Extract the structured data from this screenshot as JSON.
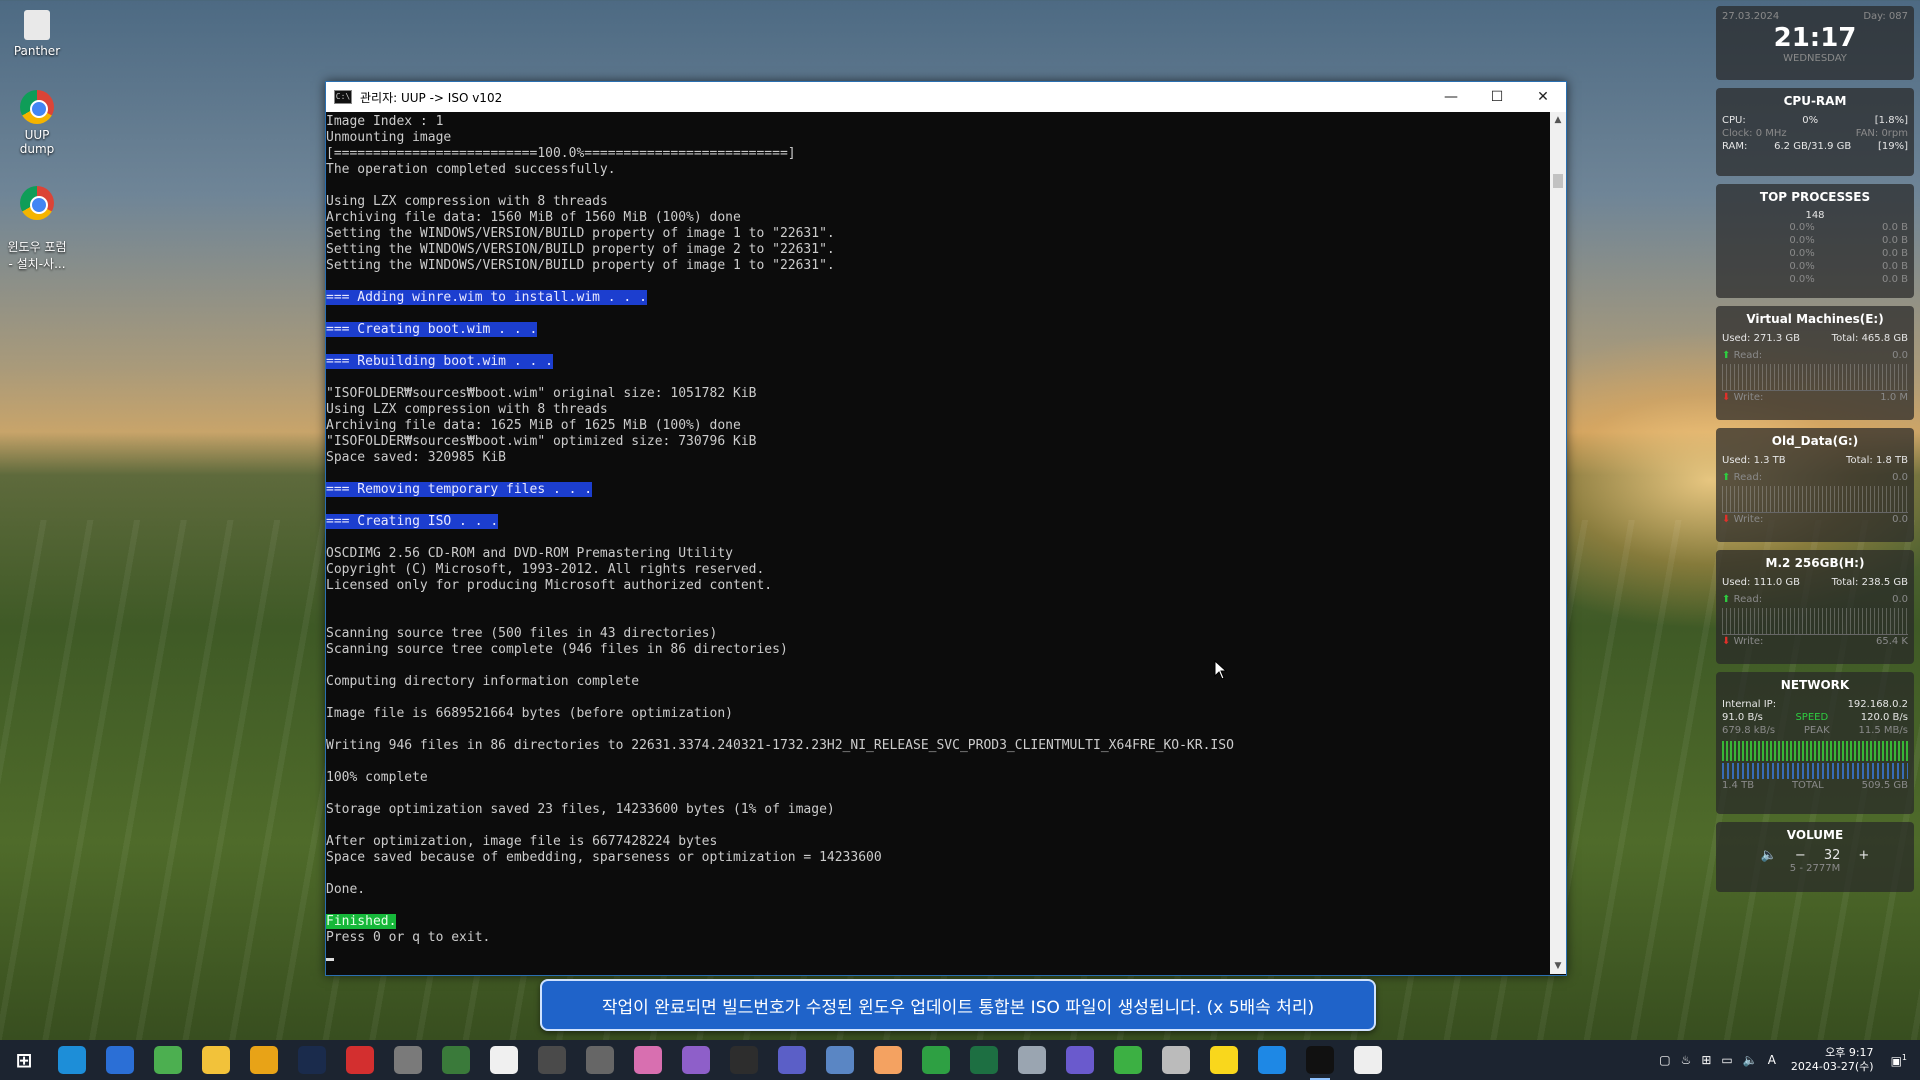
{
  "desktop": {
    "icons": [
      {
        "label": "Panther"
      },
      {
        "label": "UUP dump"
      },
      {
        "label": "윈도우 포럼\n- 설치-사..."
      }
    ]
  },
  "window": {
    "title": "관리자:  UUP -> ISO v102",
    "minimize": "—",
    "maximize": "☐",
    "close": "✕"
  },
  "console": {
    "lines": [
      {
        "text": "Image Index : 1",
        "hl": ""
      },
      {
        "text": "Unmounting image",
        "hl": ""
      },
      {
        "text": "[==========================100.0%==========================]",
        "hl": ""
      },
      {
        "text": "The operation completed successfully.",
        "hl": ""
      },
      {
        "text": "",
        "hl": ""
      },
      {
        "text": "Using LZX compression with 8 threads",
        "hl": ""
      },
      {
        "text": "Archiving file data: 1560 MiB of 1560 MiB (100%) done",
        "hl": ""
      },
      {
        "text": "Setting the WINDOWS/VERSION/BUILD property of image 1 to \"22631\".",
        "hl": ""
      },
      {
        "text": "Setting the WINDOWS/VERSION/BUILD property of image 2 to \"22631\".",
        "hl": ""
      },
      {
        "text": "Setting the WINDOWS/VERSION/BUILD property of image 1 to \"22631\".",
        "hl": ""
      },
      {
        "text": "",
        "hl": ""
      },
      {
        "text": "=== Adding winre.wim to install.wim . . .",
        "hl": "blue"
      },
      {
        "text": "",
        "hl": ""
      },
      {
        "text": "=== Creating boot.wim . . .",
        "hl": "blue"
      },
      {
        "text": "",
        "hl": ""
      },
      {
        "text": "=== Rebuilding boot.wim . . .",
        "hl": "blue"
      },
      {
        "text": "",
        "hl": ""
      },
      {
        "text": "\"ISOFOLDER₩sources₩boot.wim\" original size: 1051782 KiB",
        "hl": ""
      },
      {
        "text": "Using LZX compression with 8 threads",
        "hl": ""
      },
      {
        "text": "Archiving file data: 1625 MiB of 1625 MiB (100%) done",
        "hl": ""
      },
      {
        "text": "\"ISOFOLDER₩sources₩boot.wim\" optimized size: 730796 KiB",
        "hl": ""
      },
      {
        "text": "Space saved: 320985 KiB",
        "hl": ""
      },
      {
        "text": "",
        "hl": ""
      },
      {
        "text": "=== Removing temporary files . . .",
        "hl": "blue"
      },
      {
        "text": "",
        "hl": ""
      },
      {
        "text": "=== Creating ISO . . .",
        "hl": "blue"
      },
      {
        "text": "",
        "hl": ""
      },
      {
        "text": "OSCDIMG 2.56 CD-ROM and DVD-ROM Premastering Utility",
        "hl": ""
      },
      {
        "text": "Copyright (C) Microsoft, 1993-2012. All rights reserved.",
        "hl": ""
      },
      {
        "text": "Licensed only for producing Microsoft authorized content.",
        "hl": ""
      },
      {
        "text": "",
        "hl": ""
      },
      {
        "text": "",
        "hl": ""
      },
      {
        "text": "Scanning source tree (500 files in 43 directories)",
        "hl": ""
      },
      {
        "text": "Scanning source tree complete (946 files in 86 directories)",
        "hl": ""
      },
      {
        "text": "",
        "hl": ""
      },
      {
        "text": "Computing directory information complete",
        "hl": ""
      },
      {
        "text": "",
        "hl": ""
      },
      {
        "text": "Image file is 6689521664 bytes (before optimization)",
        "hl": ""
      },
      {
        "text": "",
        "hl": ""
      },
      {
        "text": "Writing 946 files in 86 directories to 22631.3374.240321-1732.23H2_NI_RELEASE_SVC_PROD3_CLIENTMULTI_X64FRE_KO-KR.ISO",
        "hl": ""
      },
      {
        "text": "",
        "hl": ""
      },
      {
        "text": "100% complete",
        "hl": ""
      },
      {
        "text": "",
        "hl": ""
      },
      {
        "text": "Storage optimization saved 23 files, 14233600 bytes (1% of image)",
        "hl": ""
      },
      {
        "text": "",
        "hl": ""
      },
      {
        "text": "After optimization, image file is 6677428224 bytes",
        "hl": ""
      },
      {
        "text": "Space saved because of embedding, sparseness or optimization = 14233600",
        "hl": ""
      },
      {
        "text": "",
        "hl": ""
      },
      {
        "text": "Done.",
        "hl": ""
      },
      {
        "text": "",
        "hl": ""
      },
      {
        "text": "Finished.",
        "hl": "green"
      },
      {
        "text": "Press 0 or q to exit.",
        "hl": ""
      }
    ]
  },
  "banner": {
    "text": "작업이 완료되면 빌드번호가 수정된 윈도우 업데이트 통합본 ISO 파일이 생성됩니다. (x 5배속 처리)"
  },
  "widgets": {
    "clock": {
      "date": "27.03.2024",
      "day_of_year": "Day: 087",
      "time": "21:17",
      "weekday": "WEDNESDAY"
    },
    "cpuram": {
      "title": "CPU-RAM",
      "cpu_label": "CPU:",
      "cpu_value": "0%",
      "cpu_pct": "[1.8%]",
      "clock_label": "Clock: 0 MHz",
      "fan_label": "FAN: 0rpm",
      "ram_label": "RAM:",
      "ram_value": "6.2 GB/31.9 GB",
      "ram_pct": "[19%]"
    },
    "processes": {
      "title": "TOP PROCESSES",
      "count": "148",
      "rows": [
        {
          "a": "0.0%",
          "b": "0.0 B"
        },
        {
          "a": "0.0%",
          "b": "0.0 B"
        },
        {
          "a": "0.0%",
          "b": "0.0 B"
        },
        {
          "a": "0.0%",
          "b": "0.0 B"
        },
        {
          "a": "0.0%",
          "b": "0.0 B"
        }
      ]
    },
    "drives": [
      {
        "title": "Virtual Machines(E:)",
        "used": "Used: 271.3 GB",
        "total": "Total: 465.8 GB",
        "read": "Read:",
        "read_v": "0.0",
        "write": "Write:",
        "write_v": "1.0 M"
      },
      {
        "title": "Old_Data(G:)",
        "used": "Used: 1.3 TB",
        "total": "Total: 1.8 TB",
        "read": "Read:",
        "read_v": "0.0",
        "write": "Write:",
        "write_v": "0.0"
      },
      {
        "title": "M.2 256GB(H:)",
        "used": "Used: 111.0 GB",
        "total": "Total: 238.5 GB",
        "read": "Read:",
        "read_v": "0.0",
        "write": "Write:",
        "write_v": "65.4 K"
      }
    ],
    "network": {
      "title": "NETWORK",
      "ip_label": "Internal IP:",
      "ip": "192.168.0.2",
      "down_speed": "91.0 B/s",
      "speed_label": "SPEED",
      "up_speed": "120.0 B/s",
      "down_peak": "679.8 kB/s",
      "peak_label": "PEAK",
      "up_peak": "11.5 MB/s",
      "down_total": "1.4 TB",
      "total_label": "TOTAL",
      "up_total": "509.5 GB"
    },
    "volume": {
      "title": "VOLUME",
      "minus": "−",
      "value": "32",
      "plus": "+",
      "device": "5 - 2777M"
    }
  },
  "taskbar": {
    "icons": [
      "start-icon",
      "edge-icon",
      "ie-icon",
      "chrome-icon",
      "file-explorer-icon",
      "app-yellow-icon",
      "photoshop-icon",
      "acrobat-icon",
      "tools-icon",
      "notepad-icon",
      "notes-icon",
      "obs-icon",
      "git-icon",
      "palette-icon",
      "text-info-icon",
      "dialog-icon",
      "teams-icon",
      "remote-icon",
      "note-icon",
      "green-app-icon",
      "excel-icon",
      "document-icon",
      "media-icon",
      "torrent-icon",
      "monitor-icon",
      "kakaotalk-icon",
      "virtualbox-icon",
      "terminal-icon",
      "shield-icon"
    ],
    "tray_ime": "A",
    "clock_time": "오후 9:17",
    "clock_date": "2024-03-27(수)",
    "notification_count": "1"
  },
  "colors": {
    "console_bg": "#0c0c0c",
    "console_fg": "#cccccc",
    "highlight_blue": "#1c3ecf",
    "highlight_green": "#16b83a",
    "banner_bg": "#1f63c9"
  }
}
